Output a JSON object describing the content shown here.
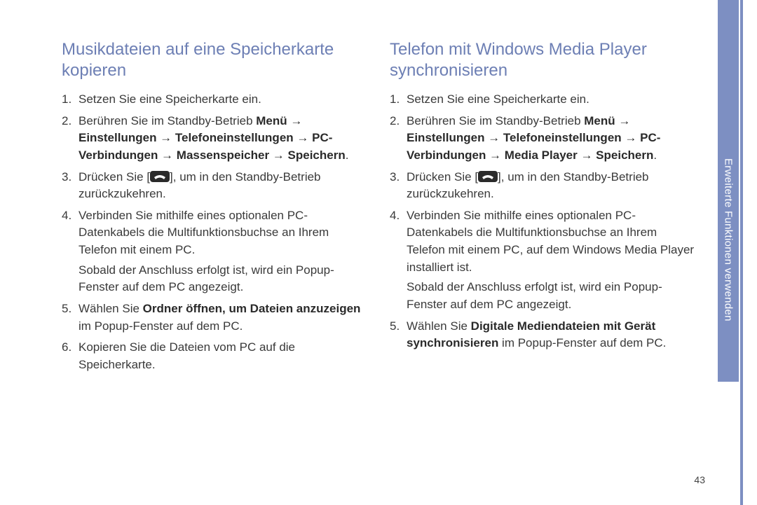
{
  "left": {
    "heading": "Musikdateien auf eine Speicherkarte kopieren",
    "steps": {
      "s1": "Setzen Sie eine Speicherkarte ein.",
      "s2_pre": "Berühren Sie im Standby-Betrieb ",
      "s2_path": "Menü → Einstellungen → Telefoneinstellungen → PC-Verbindungen → Massenspeicher → Speichern",
      "s2_post": ".",
      "s3_pre": "Drücken Sie [",
      "s3_post": "], um in den Standby-Betrieb zurückzukehren.",
      "s4": "Verbinden Sie mithilfe eines optionalen PC-Datenkabels die Multifunktionsbuchse an Ihrem Telefon mit einem PC.",
      "s4_sub": "Sobald der Anschluss erfolgt ist, wird ein Popup-Fenster auf dem PC angezeigt.",
      "s5_pre": "Wählen Sie ",
      "s5_bold": "Ordner öffnen, um Dateien anzuzeigen",
      "s5_post": " im Popup-Fenster auf dem PC.",
      "s6": "Kopieren Sie die Dateien vom PC auf die Speicherkarte."
    }
  },
  "right": {
    "heading": "Telefon mit Windows Media Player synchronisieren",
    "steps": {
      "s1": "Setzen Sie eine Speicherkarte ein.",
      "s2_pre": "Berühren Sie im Standby-Betrieb ",
      "s2_path": "Menü → Einstellungen → Telefoneinstellungen → PC-Verbindungen → Media Player → Speichern",
      "s2_post": ".",
      "s3_pre": "Drücken Sie [",
      "s3_post": "], um in den Standby-Betrieb zurückzukehren.",
      "s4": "Verbinden Sie mithilfe eines optionalen PC-Datenkabels die Multifunktionsbuchse an Ihrem Telefon mit einem PC, auf dem Windows Media Player installiert ist.",
      "s4_sub": "Sobald der Anschluss erfolgt ist, wird ein Popup-Fenster auf dem PC angezeigt.",
      "s5_pre": "Wählen Sie ",
      "s5_bold": "Digitale Mediendateien mit Gerät synchronisieren",
      "s5_post": " im Popup-Fenster auf dem PC."
    }
  },
  "side_label": "Erweiterte Funktionen verwenden",
  "page_number": "43",
  "icon_name": "end-call-key-icon"
}
